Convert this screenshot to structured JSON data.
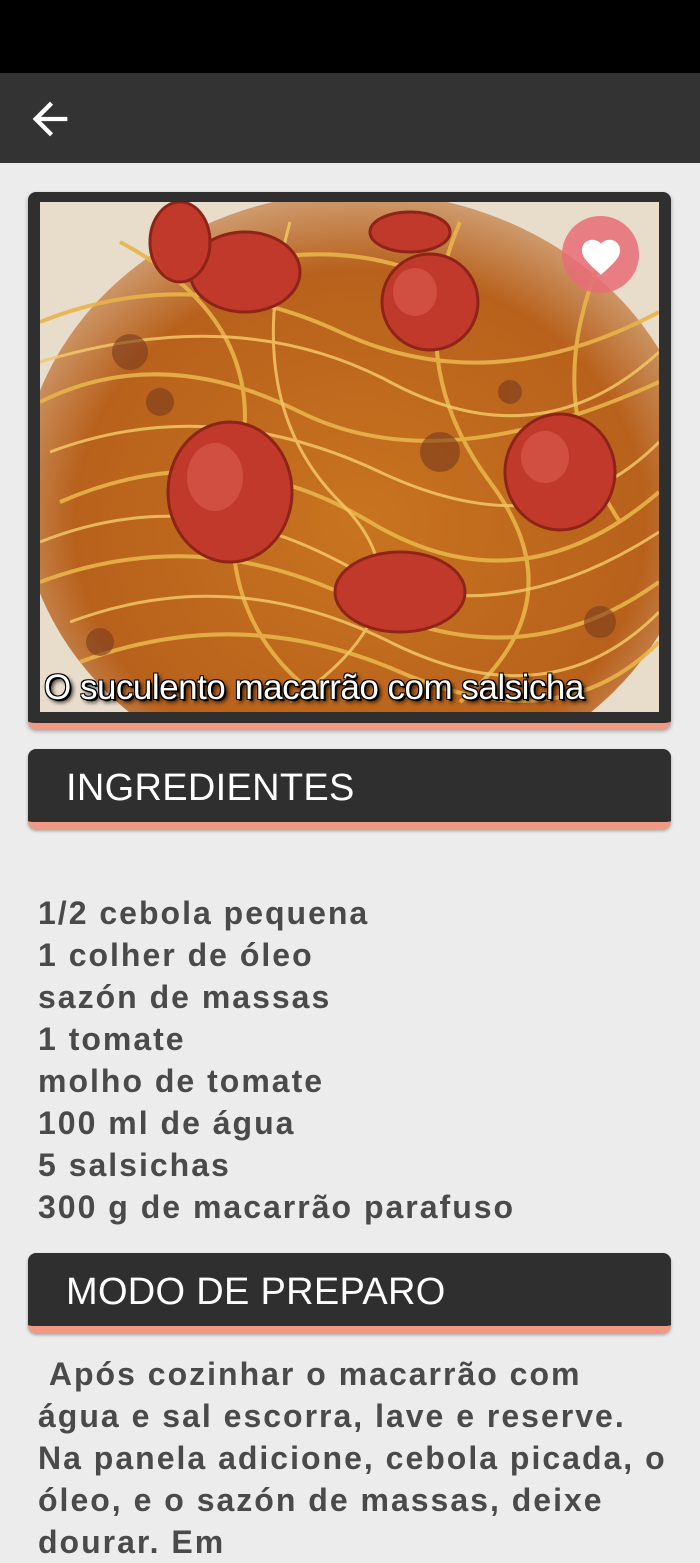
{
  "recipe": {
    "title": "O suculento macarrão com salsicha"
  },
  "icons": {
    "back": "arrow-back-icon",
    "favorite": "heart-icon"
  },
  "colors": {
    "app_bar": "#333333",
    "accent": "#f09a85",
    "favorite_bg": "#e86c78",
    "background": "#ececec"
  },
  "sections": {
    "ingredients_label": "INGREDIENTES",
    "preparation_label": "MODO DE PREPARO"
  },
  "ingredients": [
    "1/2 cebola pequena",
    "1 colher de óleo",
    "sazón de massas",
    "1 tomate",
    "molho de tomate",
    "100 ml de água",
    "5 salsichas",
    "300 g de macarrão parafuso"
  ],
  "preparation": " Após cozinhar o macarrão com água e sal escorra, lave e reserve. Na panela adicione, cebola picada, o óleo, e o sazón de massas, deixe dourar. Em"
}
